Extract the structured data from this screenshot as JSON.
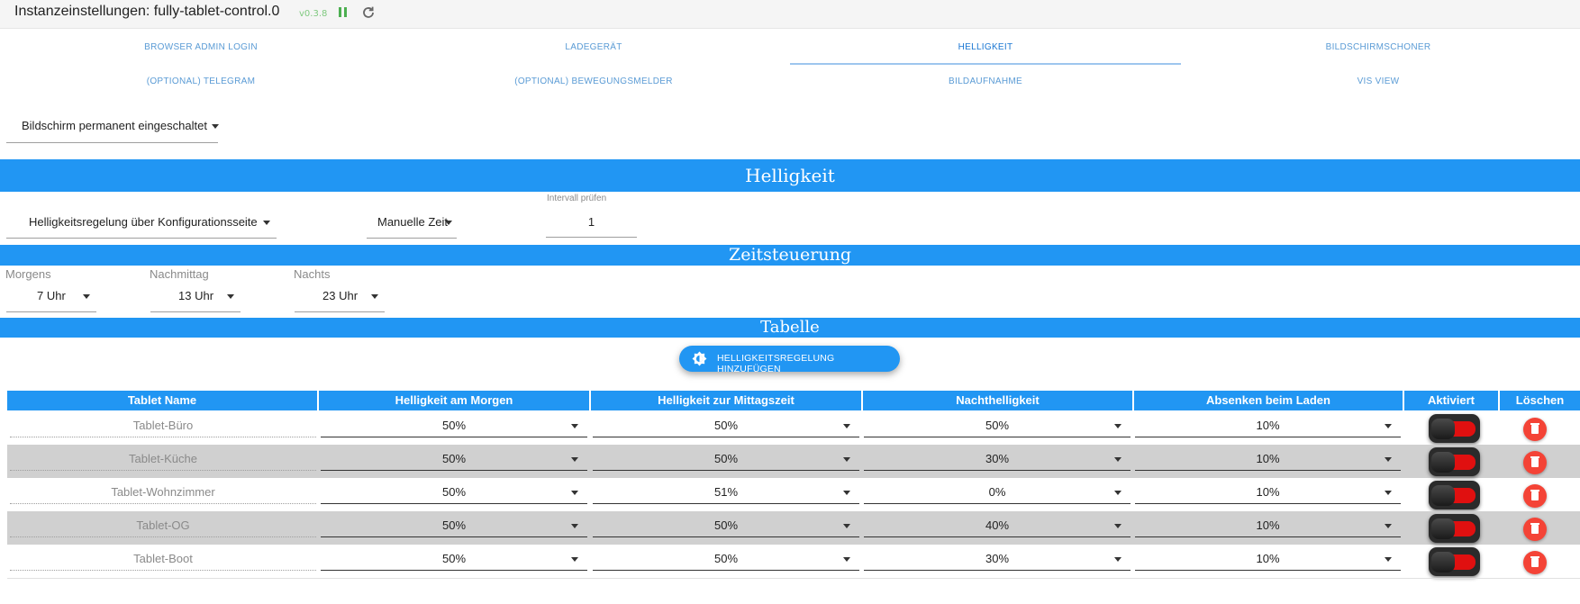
{
  "window": {
    "title": "Instanzeinstellungen: fully-tablet-control.0",
    "version": "v0.3.8",
    "pause_icon": "pause-icon",
    "refresh_icon": "refresh-icon"
  },
  "tabs": [
    {
      "label": "BROWSER ADMIN LOGIN"
    },
    {
      "label": "LADEGERÄT"
    },
    {
      "label": "HELLIGKEIT",
      "active": true
    },
    {
      "label": "BILDSCHIRMSCHONER"
    },
    {
      "label": "(OPTIONAL) TELEGRAM"
    },
    {
      "label": "(OPTIONAL) BEWEGUNGSMELDER"
    },
    {
      "label": "BILDAUFNAHME"
    },
    {
      "label": "VIS VIEW"
    }
  ],
  "screen_mode": {
    "value": "Bildschirm permanent eingeschaltet"
  },
  "helligkeit": {
    "heading": "Helligkeit",
    "mode": "Helligkeitsregelung über Konfigurationsseite",
    "time_mode": "Manuelle Zeit",
    "interval_label": "Intervall prüfen",
    "interval_value": "1"
  },
  "zeitsteuerung": {
    "heading": "Zeitsteuerung",
    "morgens": {
      "label": "Morgens",
      "value": "7 Uhr"
    },
    "nachmittag": {
      "label": "Nachmittag",
      "value": "13 Uhr"
    },
    "nachts": {
      "label": "Nachts",
      "value": "23 Uhr"
    }
  },
  "tabelle": {
    "heading": "Tabelle",
    "add_button": "HELLIGKEITSREGELUNG HINZUFÜGEN",
    "columns": [
      "Tablet Name",
      "Helligkeit am Morgen",
      "Helligkeit zur Mittagszeit",
      "Nachthelligkeit",
      "Absenken beim Laden",
      "Aktiviert",
      "Löschen"
    ],
    "rows": [
      {
        "name": "Tablet-Büro",
        "morgen": "50%",
        "mittag": "50%",
        "nacht": "50%",
        "laden": "10%",
        "aktiviert": false
      },
      {
        "name": "Tablet-Küche",
        "morgen": "50%",
        "mittag": "50%",
        "nacht": "30%",
        "laden": "10%",
        "aktiviert": false
      },
      {
        "name": "Tablet-Wohnzimmer",
        "morgen": "50%",
        "mittag": "51%",
        "nacht": "0%",
        "laden": "10%",
        "aktiviert": false
      },
      {
        "name": "Tablet-OG",
        "morgen": "50%",
        "mittag": "50%",
        "nacht": "40%",
        "laden": "10%",
        "aktiviert": false
      },
      {
        "name": "Tablet-Boot",
        "morgen": "50%",
        "mittag": "50%",
        "nacht": "30%",
        "laden": "10%",
        "aktiviert": false
      }
    ]
  },
  "colors": {
    "accent": "#2196f3",
    "delete": "#f44336",
    "toggle_track": "#e01010",
    "version": "#7fc97f"
  }
}
